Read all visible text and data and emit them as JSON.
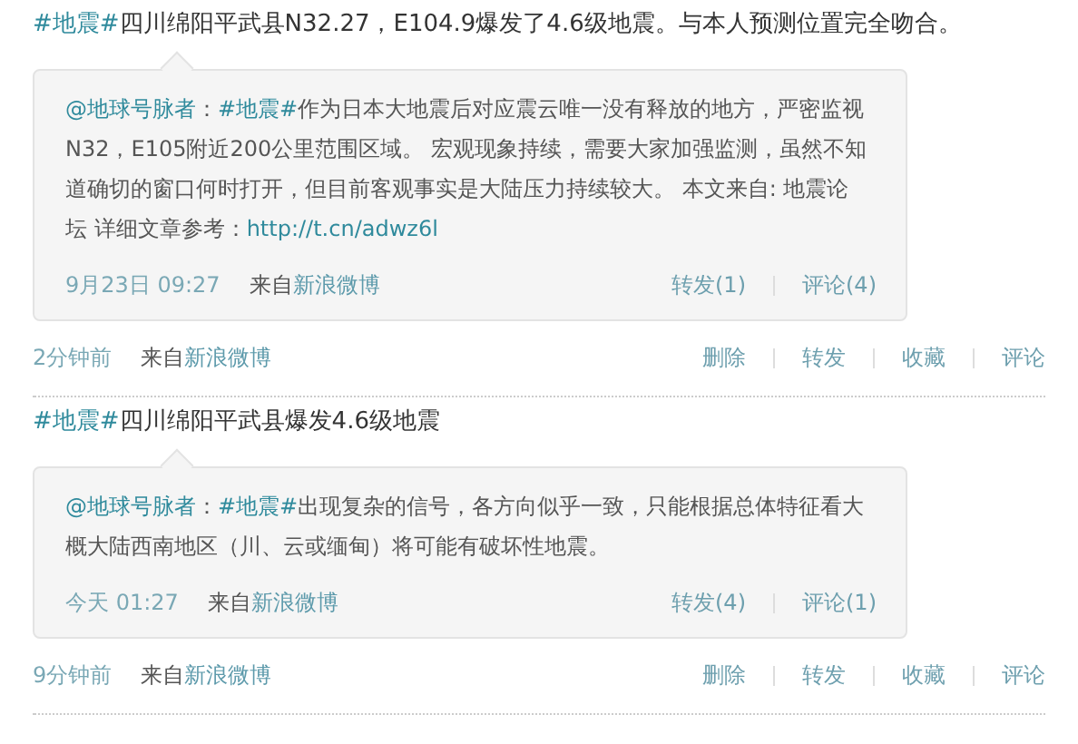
{
  "posts": [
    {
      "text": [
        {
          "kind": "topic",
          "text": "#地震#"
        },
        {
          "kind": "text",
          "text": "四川绵阳平武县N32.27，E104.9爆发了4.6级地震。与本人预测位置完全吻合。"
        }
      ],
      "quote": {
        "text": [
          {
            "kind": "mention",
            "text": "@地球号脉者"
          },
          {
            "kind": "text",
            "text": "："
          },
          {
            "kind": "topic",
            "text": "#地震#"
          },
          {
            "kind": "text",
            "text": "作为日本大地震后对应震云唯一没有释放的地方，严密监视N32，E105附近200公里范围区域。 宏观现象持续，需要大家加强监测，虽然不知道确切的窗口何时打开，但目前客观事实是大陆压力持续较大。 本文来自: 地震论坛  详细文章参考："
          },
          {
            "kind": "link",
            "text": "http://t.cn/adwz6l"
          }
        ],
        "time": "9月23日  09:27",
        "source_prefix": "来自",
        "source": "新浪微博",
        "actions": [
          "转发(1)",
          "评论(4)"
        ]
      },
      "time": "2分钟前",
      "source_prefix": "来自",
      "source": "新浪微博",
      "actions": [
        "删除",
        "转发",
        "收藏",
        "评论"
      ]
    },
    {
      "text": [
        {
          "kind": "topic",
          "text": "#地震#"
        },
        {
          "kind": "text",
          "text": "四川绵阳平武县爆发4.6级地震"
        }
      ],
      "quote": {
        "text": [
          {
            "kind": "mention",
            "text": "@地球号脉者"
          },
          {
            "kind": "text",
            "text": "："
          },
          {
            "kind": "topic",
            "text": "#地震#"
          },
          {
            "kind": "text",
            "text": "出现复杂的信号，各方向似乎一致，只能根据总体特征看大概大陆西南地区（川、云或缅甸）将可能有破坏性地震。"
          }
        ],
        "time": "今天  01:27",
        "source_prefix": "来自",
        "source": "新浪微博",
        "actions": [
          "转发(4)",
          "评论(1)"
        ]
      },
      "time": "9分钟前",
      "source_prefix": "来自",
      "source": "新浪微博",
      "actions": [
        "删除",
        "转发",
        "收藏",
        "评论"
      ]
    }
  ]
}
